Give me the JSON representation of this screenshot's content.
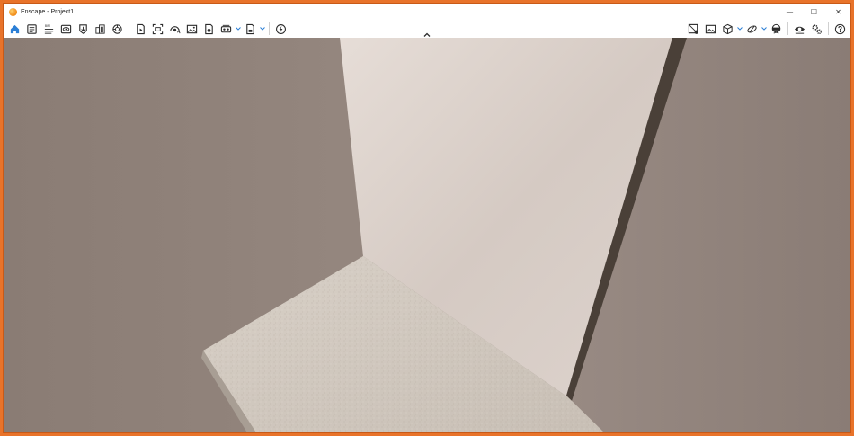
{
  "window": {
    "title": "Enscape - Project1",
    "controls": {
      "minimize": "—",
      "maximize": "☐",
      "close": "✕"
    }
  },
  "toolbar": {
    "left_group_1": [
      {
        "icon": "home-icon",
        "active": true
      },
      {
        "icon": "views-panel-icon"
      },
      {
        "icon": "bim-info-icon"
      },
      {
        "icon": "visual-settings-icon"
      },
      {
        "icon": "screenshot-export-icon"
      },
      {
        "icon": "asset-library-icon"
      },
      {
        "icon": "material-editor-icon"
      }
    ],
    "left_group_2": [
      {
        "icon": "video-editor-icon"
      },
      {
        "icon": "capture-screenshot-icon"
      },
      {
        "icon": "panorama-icon"
      },
      {
        "icon": "image-export-icon"
      },
      {
        "icon": "batch-render-icon"
      },
      {
        "icon": "vr-export-icon",
        "dropdown": true
      },
      {
        "icon": "standalone-export-icon",
        "dropdown": true
      }
    ],
    "left_group_3": [
      {
        "icon": "live-update-icon"
      }
    ],
    "right_group_1": [
      {
        "icon": "sketch-mode-icon"
      },
      {
        "icon": "gallery-icon"
      },
      {
        "icon": "view-cube-icon",
        "dropdown": true
      },
      {
        "icon": "orbit-mode-icon",
        "dropdown": true
      },
      {
        "icon": "vr-headset-icon"
      }
    ],
    "right_group_2": [
      {
        "icon": "eye-preview-icon"
      },
      {
        "icon": "settings-icon"
      }
    ],
    "right_group_3": [
      {
        "icon": "help-icon"
      }
    ]
  },
  "colors": {
    "frame": "#e8732a",
    "accent": "#2b7fd6",
    "icon": "#2c2c2c",
    "wall_left": "#8c7e76",
    "wall_back": "#d4c8c1",
    "wall_right": "#8f8079",
    "floor": "#cfc6bc",
    "shadow": "#4a4038"
  }
}
